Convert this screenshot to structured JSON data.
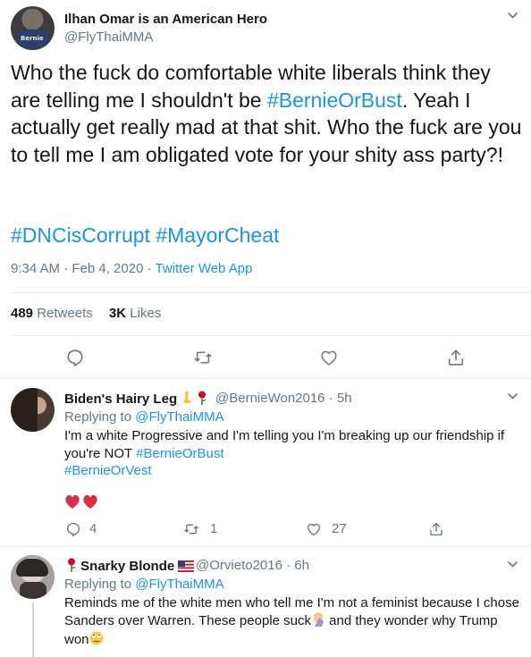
{
  "main_tweet": {
    "display_name": "Ilhan Omar is an American Hero",
    "handle": "@FlyThaiMMA",
    "avatar_shirt_text": "Bernie",
    "text_part1": "Who the fuck do comfortable white liberals think they are telling me I shouldn't be ",
    "text_hashtag": "#BernieOrBust",
    "text_part2": ". Yeah I actually get really mad at that shit. Who the fuck are you to tell me I am obligated vote for your shity ass party?!",
    "hashtag1": "#DNCisCorrupt",
    "hashtag2": "#MayorCheat",
    "timestamp": "9:34 AM · Feb 4, 2020 · ",
    "source": "Twitter Web App",
    "retweets_count": "489",
    "retweets_label": "Retweets",
    "likes_count": "3K",
    "likes_label": "Likes"
  },
  "replies": [
    {
      "display_name": "Biden's Hairy Leg",
      "handle": "@BernieWon2016 · 5h",
      "replying_prefix": "Replying to ",
      "replying_to": "@FlyThaiMMA",
      "line1": "I'm a white Progressive and I'm telling you I'm breaking up our friendship if",
      "line2_prefix": "you're NOT ",
      "line2_tag": "#BernieOrBust",
      "line3_tag": "#BernieOrVest",
      "reply_count": "4",
      "retweet_count": "1",
      "like_count": "27"
    },
    {
      "display_name": "Snarky Blonde",
      "handle": "@Orvieto2016 · 6h",
      "replying_prefix": "Replying to ",
      "replying_to": "@FlyThaiMMA",
      "line1": "Reminds me of the white men who tell me I'm not a feminist because I chose",
      "line2": "Sanders over Warren. These people suck",
      "line2_suffix": " and they wonder why Trump",
      "line3": "won"
    }
  ],
  "icons": {
    "reply": "reply-icon",
    "retweet": "retweet-icon",
    "like": "heart-icon",
    "share": "share-icon",
    "caret": "chevron-down-icon"
  },
  "colors": {
    "link": "#1b95e0",
    "secondary_text": "#657786",
    "primary_text": "#14171a",
    "divider": "#e6ecf0"
  }
}
